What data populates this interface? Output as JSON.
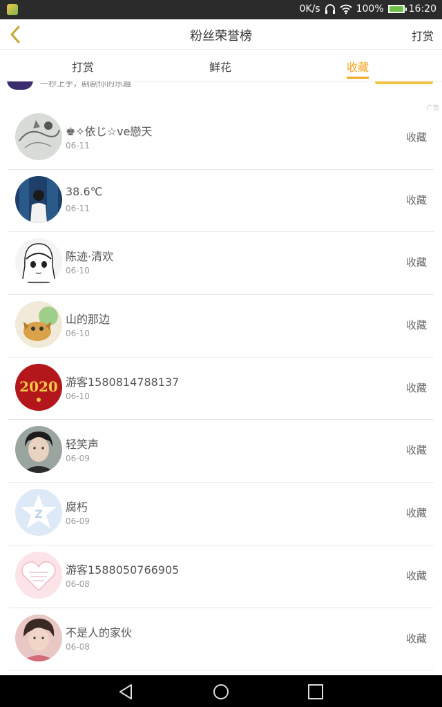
{
  "status_bar": {
    "speed": "0K/s",
    "battery": "100%",
    "time": "16:20"
  },
  "titlebar": {
    "title": "粉丝荣誉榜",
    "action": "打赏"
  },
  "tabs": [
    {
      "label": "打赏",
      "active": false
    },
    {
      "label": "鲜花",
      "active": false
    },
    {
      "label": "收藏",
      "active": true
    }
  ],
  "ad": {
    "text": "一秒上手，剧剧你的乐趣",
    "tag": "广告"
  },
  "list": [
    {
      "name": "♚✧依じ☆ve戀天",
      "date": "06-11",
      "type": "收藏",
      "avatar": "sketch-gray"
    },
    {
      "name": "38.6℃",
      "date": "06-11",
      "type": "收藏",
      "avatar": "photo-blue"
    },
    {
      "name": "陈迹·清欢",
      "date": "06-10",
      "type": "收藏",
      "avatar": "manga-face"
    },
    {
      "name": "山的那边",
      "date": "06-10",
      "type": "收藏",
      "avatar": "cartoon-dog"
    },
    {
      "name": "游客1580814788137",
      "date": "06-10",
      "type": "收藏",
      "avatar": "red-2020"
    },
    {
      "name": "轻笑声",
      "date": "06-09",
      "type": "收藏",
      "avatar": "portrait-boy"
    },
    {
      "name": "腐朽",
      "date": "06-09",
      "type": "收藏",
      "avatar": "default-star"
    },
    {
      "name": "游客1588050766905",
      "date": "06-08",
      "type": "收藏",
      "avatar": "pink-heart"
    },
    {
      "name": "不是人的家伙",
      "date": "06-08",
      "type": "收藏",
      "avatar": "portrait-girl"
    }
  ],
  "colors": {
    "accent": "#f5a623",
    "back_arrow": "#c9a431"
  }
}
